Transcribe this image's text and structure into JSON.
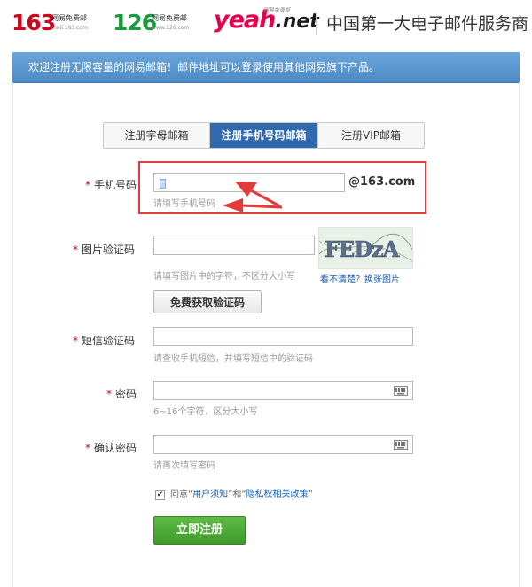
{
  "header": {
    "logo163": {
      "number": "163",
      "cn": "网易免费邮",
      "domain": "mail.163.com",
      "color": "#d0021b"
    },
    "logo126": {
      "number": "126",
      "cn": "网易免费邮",
      "domain": "www.126.com",
      "color": "#1a9a3c"
    },
    "logoyeah": {
      "word": "yeah",
      "suffix": ".net",
      "tag": "网易免费邮",
      "color": "#e4004f"
    },
    "slogan": "中国第一大电子邮件服务商"
  },
  "banner": {
    "text": "欢迎注册无限容量的网易邮箱！邮件地址可以登录使用其他网易旗下产品。",
    "color": "#5b97cf"
  },
  "tabs": [
    {
      "label": "注册字母邮箱",
      "active": false
    },
    {
      "label": "注册手机号码邮箱",
      "active": true
    },
    {
      "label": "注册VIP邮箱",
      "active": false
    }
  ],
  "form": {
    "required_mark": "*",
    "phone": {
      "label": "手机号码",
      "value": "",
      "suffix": "@163.com",
      "hint": "请填写手机号码"
    },
    "captcha": {
      "label": "图片验证码",
      "value": "",
      "hint": "请填写图片中的字符，不区分大小写",
      "refresh_link": "看不清楚？换张图片",
      "image_text": "FEDzA"
    },
    "get_sms_button": "免费获取验证码",
    "sms": {
      "label": "短信验证码",
      "value": "",
      "hint": "请查收手机短信，并填写短信中的验证码"
    },
    "password": {
      "label": "密码",
      "value": "",
      "hint": "6~16个字符，区分大小写",
      "icon": "keyboard-icon"
    },
    "confirm": {
      "label": "确认密码",
      "value": "",
      "hint": "请再次填写密码",
      "icon": "keyboard-icon"
    },
    "agreement": {
      "checked": true,
      "prefix": "同意",
      "q1": "“",
      "terms": "用户须知",
      "q2": "”",
      "and": "和",
      "q3": "“",
      "privacy": "隐私权相关政策",
      "q4": "”"
    },
    "submit": "立即注册"
  },
  "colors": {
    "accent_blue": "#2f6ab0",
    "highlight_red": "#e53a3a",
    "submit_green": "#4aa734",
    "link": "#1a5fb4"
  }
}
